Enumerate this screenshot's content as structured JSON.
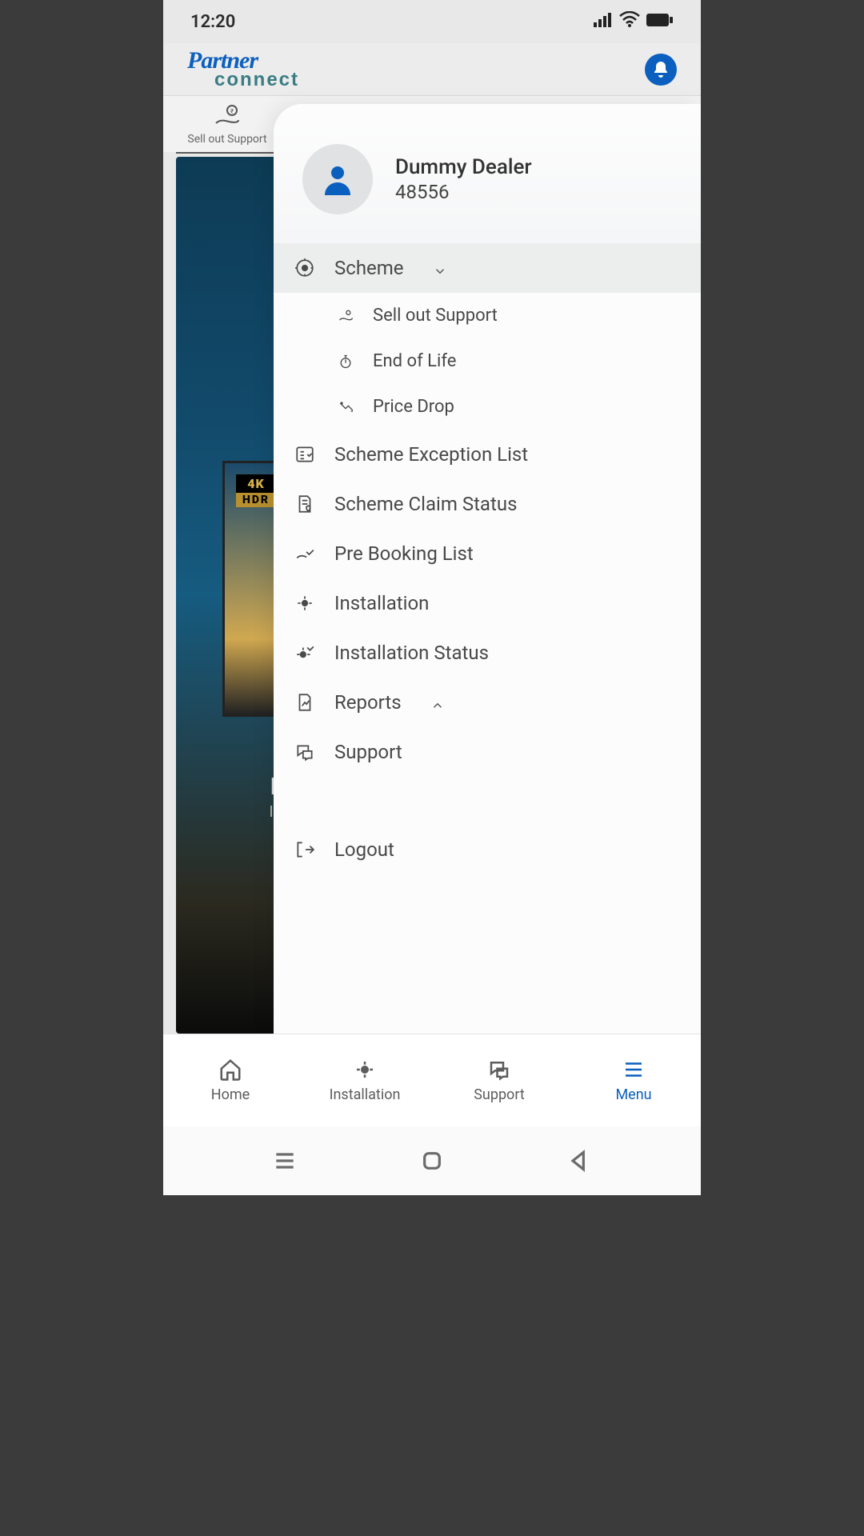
{
  "status": {
    "time": "12:20"
  },
  "brand": {
    "line1": "Partner",
    "line2": "connect"
  },
  "backTab": {
    "label": "Sell out Support"
  },
  "hero": {
    "badge1": "4K",
    "badge2": "HDR",
    "title": "BRAVIA",
    "sub": "OLED"
  },
  "profile": {
    "name": "Dummy Dealer",
    "id": "48556"
  },
  "menu": {
    "scheme": "Scheme",
    "schemeItems": {
      "sell_out": "Sell out Support",
      "eol": "End of Life",
      "price_drop": "Price Drop"
    },
    "exception": "Scheme Exception List",
    "claim": "Scheme Claim Status",
    "prebook": "Pre Booking List",
    "install": "Installation",
    "installStatus": "Installation Status",
    "reports": "Reports",
    "support": "Support",
    "logout": "Logout"
  },
  "bottomNav": {
    "home": "Home",
    "installation": "Installation",
    "support": "Support",
    "menu": "Menu"
  }
}
